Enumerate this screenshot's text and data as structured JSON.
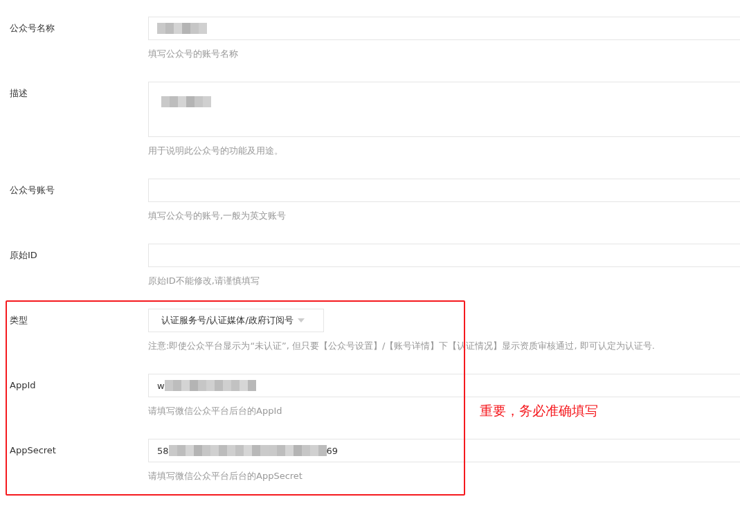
{
  "fields": [
    {
      "label": "公众号名称",
      "kind": "input",
      "redacted": true,
      "help": "填写公众号的账号名称"
    },
    {
      "label": "描述",
      "kind": "textarea",
      "redacted": true,
      "help": "用于说明此公众号的功能及用途。"
    },
    {
      "label": "公众号账号",
      "kind": "input",
      "redacted": false,
      "help": "填写公众号的账号,一般为英文账号"
    },
    {
      "label": "原始ID",
      "kind": "input",
      "redacted": false,
      "help": "原始ID不能修改,请谨慎填写"
    },
    {
      "label": "类型",
      "kind": "select",
      "value_start": "认证服务号/认证媒体/政府订阅号",
      "redacted": false,
      "help": "注意:即使公众平台显示为“未认证”, 但只要【公众号设置】/【账号详情】下【认证情况】显示资质审核通过, 即可认定为认证号."
    },
    {
      "label": "AppId",
      "kind": "input",
      "value_start": "w",
      "redacted": true,
      "help": "请填写微信公众平台后台的AppId"
    },
    {
      "label": "AppSecret",
      "kind": "input",
      "value_start": "58",
      "value_end": "69",
      "redacted": true,
      "help": "请填写微信公众平台后台的AppSecret"
    }
  ],
  "annotation": {
    "text": "重要，务必准确填写"
  }
}
